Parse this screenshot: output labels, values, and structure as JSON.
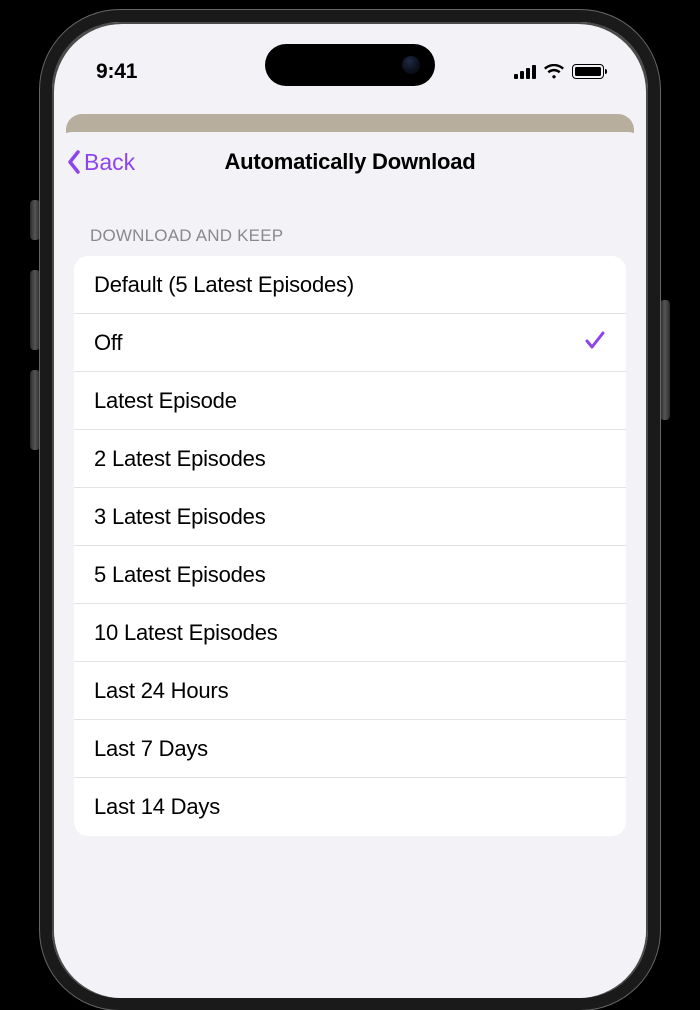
{
  "status": {
    "time": "9:41"
  },
  "nav": {
    "back_label": "Back",
    "title": "Automatically Download"
  },
  "section": {
    "header": "DOWNLOAD AND KEEP"
  },
  "selected_index": 1,
  "options": [
    {
      "label": "Default (5 Latest Episodes)"
    },
    {
      "label": "Off"
    },
    {
      "label": "Latest Episode"
    },
    {
      "label": "2 Latest Episodes"
    },
    {
      "label": "3 Latest Episodes"
    },
    {
      "label": "5 Latest Episodes"
    },
    {
      "label": "10 Latest Episodes"
    },
    {
      "label": "Last 24 Hours"
    },
    {
      "label": "Last 7 Days"
    },
    {
      "label": "Last 14 Days"
    }
  ],
  "accent_color": "#8e44ec"
}
